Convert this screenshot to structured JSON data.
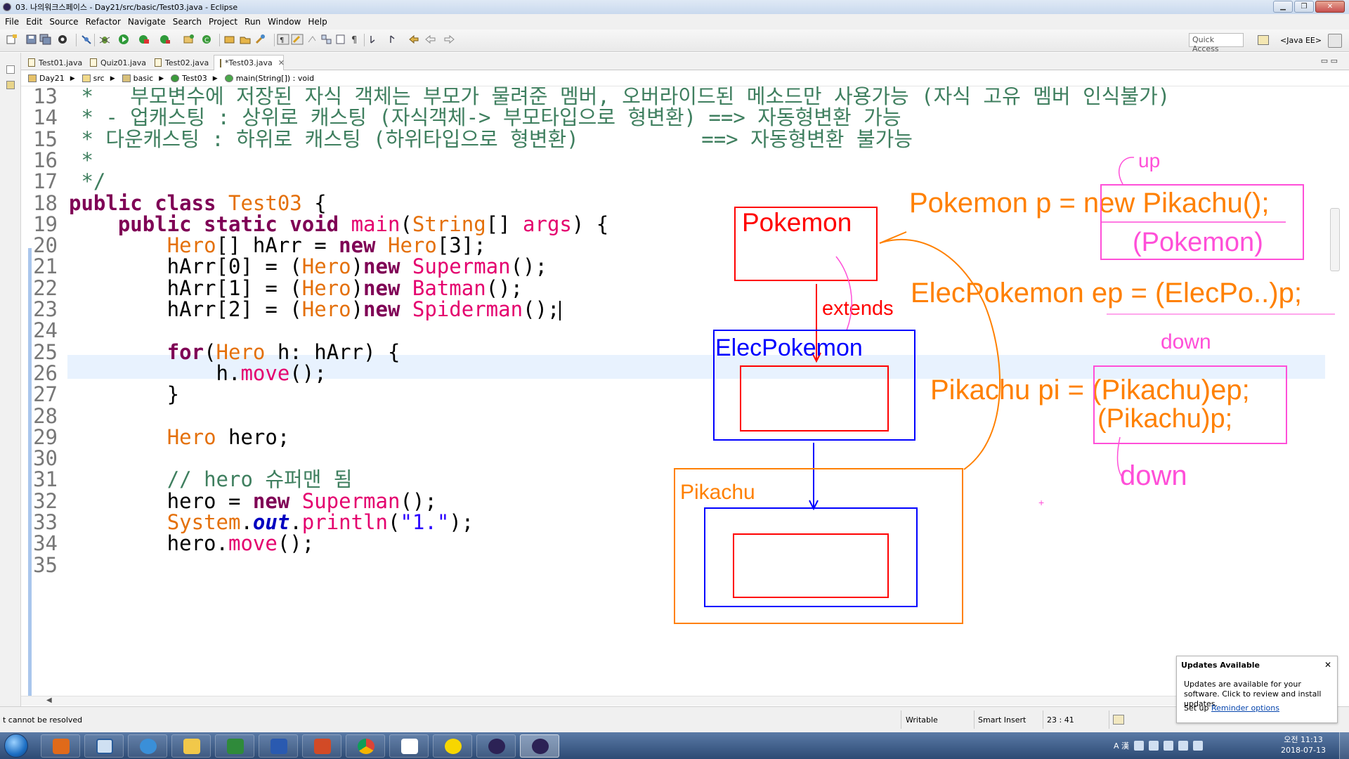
{
  "window": {
    "title": "03. 나의워크스페이스 - Day21/src/basic/Test03.java - Eclipse",
    "buttons": [
      "▁",
      "❐",
      "✕"
    ]
  },
  "menu": [
    "File",
    "Edit",
    "Source",
    "Refactor",
    "Navigate",
    "Search",
    "Project",
    "Run",
    "Window",
    "Help"
  ],
  "toolbar": {
    "quick_access_placeholder": "Quick Access",
    "perspective": "<Java EE>"
  },
  "tabs": [
    {
      "label": "Test01.java",
      "active": false
    },
    {
      "label": "Quiz01.java",
      "active": false
    },
    {
      "label": "Test02.java",
      "active": false
    },
    {
      "label": "*Test03.java",
      "active": true
    }
  ],
  "tab_controls": "▭  ▭",
  "breadcrumb": [
    "Day21",
    "src",
    "basic",
    "Test03",
    "main(String[]) : void"
  ],
  "code": {
    "lines": [
      {
        "n": "13",
        "parts": [
          [
            "cm",
            " *   부모변수에 저장된 자식 객체는 부모가 물려준 멤버, 오버라이드된 메소드만 사용가능 (자식 고유 멤버 인식불가)"
          ]
        ]
      },
      {
        "n": "14",
        "parts": [
          [
            "cm",
            " * - 업캐스팅 : 상위로 캐스팅 (자식객체-> 부모타입으로 형변환) ==> 자동형변환 가능"
          ]
        ]
      },
      {
        "n": "15",
        "parts": [
          [
            "cm",
            " * 다운캐스팅 : 하위로 캐스팅 (하위타입으로 형변환)          ==> 자동형변환 불가능"
          ]
        ]
      },
      {
        "n": "16",
        "parts": [
          [
            "cm",
            " *"
          ]
        ]
      },
      {
        "n": "17",
        "parts": [
          [
            "cm",
            " */"
          ]
        ]
      },
      {
        "n": "18",
        "parts": [
          [
            "kw",
            "public class "
          ],
          [
            "ty",
            "Test03"
          ],
          [
            "",
            " {"
          ]
        ]
      },
      {
        "n": "19",
        "parts": [
          [
            "",
            "    "
          ],
          [
            "kw",
            "public static void "
          ],
          [
            "fn",
            "main"
          ],
          [
            "",
            "("
          ],
          [
            "ty",
            "String"
          ],
          [
            "",
            "[] "
          ],
          [
            "fn",
            "args"
          ],
          [
            "",
            ") {"
          ]
        ]
      },
      {
        "n": "20",
        "parts": [
          [
            "",
            "        "
          ],
          [
            "ty",
            "Hero"
          ],
          [
            "",
            "[] hArr = "
          ],
          [
            "kw",
            "new "
          ],
          [
            "ty",
            "Hero"
          ],
          [
            "",
            "[3];"
          ]
        ]
      },
      {
        "n": "21",
        "parts": [
          [
            "",
            "        hArr[0] = ("
          ],
          [
            "ty",
            "Hero"
          ],
          [
            "",
            ")"
          ],
          [
            "kw",
            "new "
          ],
          [
            "fn",
            "Superman"
          ],
          [
            "",
            "();"
          ]
        ]
      },
      {
        "n": "22",
        "parts": [
          [
            "",
            "        hArr[1] = ("
          ],
          [
            "ty",
            "Hero"
          ],
          [
            "",
            ")"
          ],
          [
            "kw",
            "new "
          ],
          [
            "fn",
            "Batman"
          ],
          [
            "",
            "();"
          ]
        ]
      },
      {
        "n": "23",
        "parts": [
          [
            "",
            "        hArr[2] = ("
          ],
          [
            "ty",
            "Hero"
          ],
          [
            "",
            ")"
          ],
          [
            "kw",
            "new "
          ],
          [
            "fn",
            "Spiderman"
          ],
          [
            "",
            "();"
          ],
          [
            "cursor",
            ""
          ]
        ]
      },
      {
        "n": "24",
        "parts": []
      },
      {
        "n": "25",
        "parts": [
          [
            "",
            "        "
          ],
          [
            "kw",
            "for"
          ],
          [
            "",
            "("
          ],
          [
            "ty",
            "Hero"
          ],
          [
            "",
            " h: hArr) {"
          ]
        ]
      },
      {
        "n": "26",
        "parts": [
          [
            "",
            "            h."
          ],
          [
            "fn",
            "move"
          ],
          [
            "",
            "();"
          ]
        ]
      },
      {
        "n": "27",
        "parts": [
          [
            "",
            "        }"
          ]
        ]
      },
      {
        "n": "28",
        "parts": []
      },
      {
        "n": "29",
        "parts": [
          [
            "",
            "        "
          ],
          [
            "ty",
            "Hero"
          ],
          [
            "",
            " hero;"
          ]
        ]
      },
      {
        "n": "30",
        "parts": []
      },
      {
        "n": "31",
        "parts": [
          [
            "",
            "        "
          ],
          [
            "cm",
            "// hero 슈퍼맨 됨"
          ]
        ]
      },
      {
        "n": "32",
        "parts": [
          [
            "",
            "        hero = "
          ],
          [
            "kw",
            "new "
          ],
          [
            "fn",
            "Superman"
          ],
          [
            "",
            "();"
          ]
        ]
      },
      {
        "n": "33",
        "parts": [
          [
            "",
            "        "
          ],
          [
            "ty",
            "System"
          ],
          [
            "",
            "."
          ],
          [
            "fd",
            "out"
          ],
          [
            "",
            "."
          ],
          [
            "fn",
            "println"
          ],
          [
            "",
            "("
          ],
          [
            "st",
            "\"1.\""
          ],
          [
            "",
            ");"
          ]
        ]
      },
      {
        "n": "34",
        "parts": [
          [
            "",
            "        hero."
          ],
          [
            "fn",
            "move"
          ],
          [
            "",
            "();"
          ]
        ]
      },
      {
        "n": "35",
        "parts": []
      }
    ]
  },
  "annotations": {
    "pokemon_box": "Pokemon",
    "extends_label": "extends",
    "elecpokemon_box": "ElecPokemon",
    "pikachu_box": "Pikachu",
    "note_up_label": "up",
    "note1": "Pokemon p = new Pikachu();",
    "note1_cast": "(Pokemon)",
    "note2": "ElecPokemon ep = (ElecPo..)p;",
    "note2_down": "down",
    "note3_line1": "Pikachu pi = (Pikachu)ep;",
    "note3_line2": "(Pikachu)p;",
    "note3_down": "down",
    "colors": {
      "red": "#ff0000",
      "blue": "#0000ff",
      "orange": "#ff8000",
      "magenta": "#ff4fd8"
    }
  },
  "status": {
    "message": "t cannot be resolved",
    "writable": "Writable",
    "insert_mode": "Smart Insert",
    "position": "23 : 41"
  },
  "notification": {
    "title": "Updates Available",
    "body": "Updates are available for your software. Click to review and install updates.",
    "setup_prefix": "Set up",
    "setup_link": "Reminder options"
  },
  "taskbar": {
    "apps": [
      "media-player",
      "magnifier",
      "internet-explorer",
      "file-explorer",
      "excel",
      "word",
      "powerpoint",
      "chrome",
      "hangouts",
      "kakaotalk",
      "eclipse",
      "eclipse"
    ],
    "clock_time": "오전 11:13",
    "clock_date": "2018-07-13",
    "ime": "A 漢"
  }
}
